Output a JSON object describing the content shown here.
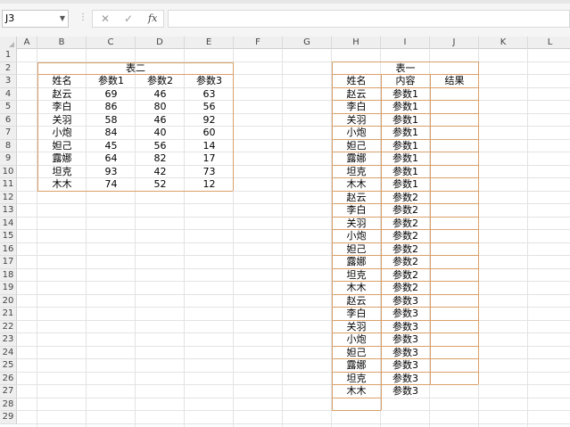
{
  "formula_bar": {
    "name_box": "J3",
    "cancel": "✕",
    "enter": "✓",
    "fx": "fx",
    "formula": ""
  },
  "columns": [
    "A",
    "B",
    "C",
    "D",
    "E",
    "F",
    "G",
    "H",
    "I",
    "J",
    "K",
    "L"
  ],
  "rows": [
    "1",
    "2",
    "3",
    "4",
    "5",
    "6",
    "7",
    "8",
    "9",
    "10",
    "11",
    "12",
    "13",
    "14",
    "15",
    "16",
    "17",
    "18",
    "19",
    "20",
    "21",
    "22",
    "23",
    "24",
    "25",
    "26",
    "27",
    "28",
    "29"
  ],
  "table2": {
    "title": "表二",
    "headers": [
      "姓名",
      "参数1",
      "参数2",
      "参数3"
    ],
    "rows": [
      [
        "赵云",
        "69",
        "46",
        "63"
      ],
      [
        "李白",
        "86",
        "80",
        "56"
      ],
      [
        "关羽",
        "58",
        "46",
        "92"
      ],
      [
        "小炮",
        "84",
        "40",
        "60"
      ],
      [
        "妲己",
        "45",
        "56",
        "14"
      ],
      [
        "露娜",
        "64",
        "82",
        "17"
      ],
      [
        "坦克",
        "93",
        "42",
        "73"
      ],
      [
        "木木",
        "74",
        "52",
        "12"
      ]
    ]
  },
  "table1": {
    "title": "表一",
    "headers": [
      "姓名",
      "内容",
      "结果"
    ],
    "rows": [
      [
        "赵云",
        "参数1",
        ""
      ],
      [
        "李白",
        "参数1",
        ""
      ],
      [
        "关羽",
        "参数1",
        ""
      ],
      [
        "小炮",
        "参数1",
        ""
      ],
      [
        "妲己",
        "参数1",
        ""
      ],
      [
        "露娜",
        "参数1",
        ""
      ],
      [
        "坦克",
        "参数1",
        ""
      ],
      [
        "木木",
        "参数1",
        ""
      ],
      [
        "赵云",
        "参数2",
        ""
      ],
      [
        "李白",
        "参数2",
        ""
      ],
      [
        "关羽",
        "参数2",
        ""
      ],
      [
        "小炮",
        "参数2",
        ""
      ],
      [
        "妲己",
        "参数2",
        ""
      ],
      [
        "露娜",
        "参数2",
        ""
      ],
      [
        "坦克",
        "参数2",
        ""
      ],
      [
        "木木",
        "参数2",
        ""
      ],
      [
        "赵云",
        "参数3",
        ""
      ],
      [
        "李白",
        "参数3",
        ""
      ],
      [
        "关羽",
        "参数3",
        ""
      ],
      [
        "小炮",
        "参数3",
        ""
      ],
      [
        "妲己",
        "参数3",
        ""
      ],
      [
        "露娜",
        "参数3",
        ""
      ],
      [
        "坦克",
        "参数3",
        ""
      ],
      [
        "木木",
        "参数3",
        ""
      ]
    ]
  },
  "colors": {
    "border_accent": "#d9a06a",
    "header_bg": "#efefef"
  }
}
